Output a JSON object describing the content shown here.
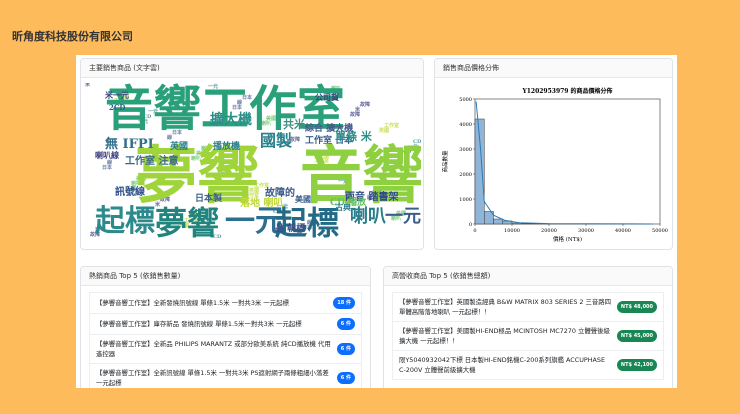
{
  "company": "昕角度科技股份有限公司",
  "wordcloud": {
    "title": "主要銷售商品 (文字雲)",
    "words": [
      "音響工作室",
      "夢響",
      "音響",
      "起標",
      "夢響",
      "一元",
      "起標",
      "喇叭",
      "一元",
      "國製",
      "擴大機",
      "共米",
      "無 IFPI",
      "工作室 日本",
      "單條 米",
      "訊號線",
      "日本製",
      "兩音 踏書架",
      "綜合 擴大機",
      "故障的",
      "米一元",
      "公司貨",
      "工作室 注意",
      "英國",
      "品 朝標",
      "落地 喇叭",
      "CD 播放",
      "美國",
      "古典",
      "播放機",
      "喇叭線",
      "2CD"
    ]
  },
  "histogram": {
    "title": "銷售商品價格分佈"
  },
  "chart_data": {
    "type": "bar",
    "title": "Y1202953979 的商品價格分佈",
    "xlabel": "價格 (NT$)",
    "ylabel": "商品數量",
    "xlim": [
      0,
      50000
    ],
    "ylim": [
      0,
      5000
    ],
    "xticks": [
      "0",
      "10000",
      "20000",
      "30000",
      "40000",
      "50000"
    ],
    "yticks": [
      "0",
      "1000",
      "2000",
      "3000",
      "4000",
      "5000"
    ],
    "bins": [
      0,
      2500,
      5000,
      7500,
      10000,
      12500,
      15000,
      20000,
      30000,
      40000,
      48000
    ],
    "values": [
      4200,
      500,
      200,
      120,
      40,
      20,
      12,
      8,
      4,
      2
    ],
    "kde_peak": 4900
  },
  "top_qty": {
    "title": "熱銷商品 Top 5 (依銷售數量)",
    "items": [
      {
        "name": "【夢響音響工作室】全新發燒訊號線 單條1.5米 一對共3米 一元起標",
        "badge": "18 件"
      },
      {
        "name": "【夢響音響工作室】庫存新品 發燒訊號線 單條1.5米一對共3米 一元起標",
        "badge": "6 件"
      },
      {
        "name": "【夢響音響工作室】全新品 PHILIPS MARANTZ 或部分歐美系統 純CD播放機 代用遙控器",
        "badge": "6 件"
      },
      {
        "name": "【夢響音響工作室】全新訊號線 單條1.5米 一對共3米 PS遮射網子兩條粗細小落差 一元起標",
        "badge": "6 件"
      }
    ]
  },
  "top_rev": {
    "title": "高營收商品 Top 5 (依銷售總額)",
    "items": [
      {
        "name": "【夢響音響工作室】英國製造經典 B&W MATRIX 803 SERIES 2 三音路四單體高階落地喇叭 一元起標！！",
        "badge": "NT$ 48,000"
      },
      {
        "name": "【夢響音響工作室】美國製HI-END極品 MCINTOSH MC7270 立體聲後級擴大機 一元起標！！",
        "badge": "NT$ 45,000"
      },
      {
        "name": "限Y5040932042下標 日本製HI-END銘機C-200系列旗艦 ACCUPHASE C-200V 立體聲前級擴大機",
        "badge": "NT$ 42,100"
      }
    ]
  }
}
